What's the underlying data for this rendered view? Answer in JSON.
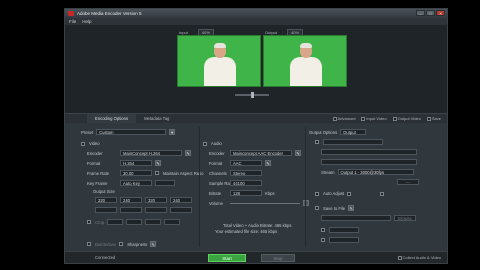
{
  "window": {
    "title": "Adobe Media Encoder Version 5",
    "minimize": "–",
    "maximize": "□",
    "close": "✕"
  },
  "menu": [
    "File",
    "Help"
  ],
  "preview": {
    "input_label": "Input",
    "input_zoom": "40%",
    "output_label": "Output",
    "output_zoom": "40%"
  },
  "tabs": [
    "Encoding Options",
    "Metadata Tag"
  ],
  "toolbar_right": {
    "advanced": "Advanced",
    "input_video": "Input Video",
    "output video": "Output Video",
    "save": "Save"
  },
  "preset": {
    "label": "Preset",
    "value": "Custom"
  },
  "video": {
    "header": "Video",
    "codec_label": "Encoder",
    "codec_value": "MainConcept H.264",
    "format_label": "Format",
    "format_value": "H.264",
    "frame_rate_label": "Frame Rate",
    "frame_rate_value": "30.00",
    "key_frame_label": "Key Frame",
    "key_frame_value": "Auto Key",
    "maintain_aspect": "Maintain Aspect Ratio",
    "size_label": "Output Size",
    "input_w": "320",
    "input_h": "240",
    "output_w": "320",
    "output_h": "240",
    "crop_label": "Crop",
    "deinterlace_label": "Deinterlace",
    "sharpness_label": "Sharpness"
  },
  "audio": {
    "header": "Audio",
    "codec_label": "Encoder",
    "codec_value": "Mainconcept AAC Encoder",
    "format_label": "Format",
    "format_value": "AAC",
    "channels_label": "Channels",
    "channels_value": "Stereo",
    "sample_rate_label": "Sample Rate",
    "sample_rate_value": "44100",
    "bitrate_label": "Bitrate",
    "bitrate_value": "128",
    "bitrate_unit": "Kbps",
    "volume_label": "Volume",
    "total_video_line": "Total Video + Audio Bitrate: 465 kbps",
    "total_file_line": "Your estimated file size: 465 kbps"
  },
  "output_panel": {
    "header": "Output Options",
    "mode_value": "Output",
    "stream_name_label": "Stream",
    "stream_name_value": "Output 1 - 3000@30fps",
    "cue_points_label": "Auto Adjust",
    "save_to_file_label": "Save to File",
    "browse_label": "Browse"
  },
  "status": {
    "connected": "Connected",
    "start": "Start",
    "stop": "Stop",
    "right_text": "Collect Audio & Video"
  },
  "colors": {
    "accent_green": "#3aa53f",
    "chroma_green": "#3fb448"
  }
}
